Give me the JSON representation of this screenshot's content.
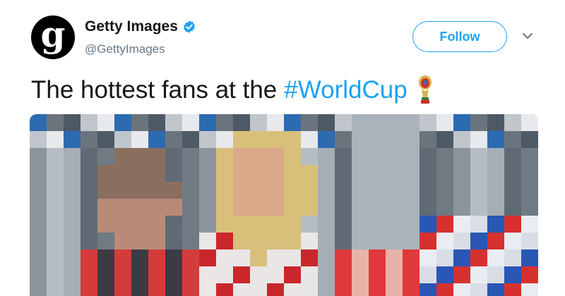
{
  "account": {
    "avatar_letter": "g",
    "name": "Getty Images",
    "handle": "@GettyImages",
    "verified": true
  },
  "actions": {
    "follow_label": "Follow",
    "menu_icon": "chevron-down-icon"
  },
  "tweet": {
    "text": "The hottest fans at the",
    "hashtag": "#WorldCup",
    "emoji_icon": "world-cup-trophy-icon"
  },
  "media": {
    "description_icon": "pixelated-photo",
    "pixelated": true
  },
  "colors": {
    "brand_blue": "#1da1f2",
    "text_primary": "#14171a",
    "text_secondary": "#657786"
  }
}
